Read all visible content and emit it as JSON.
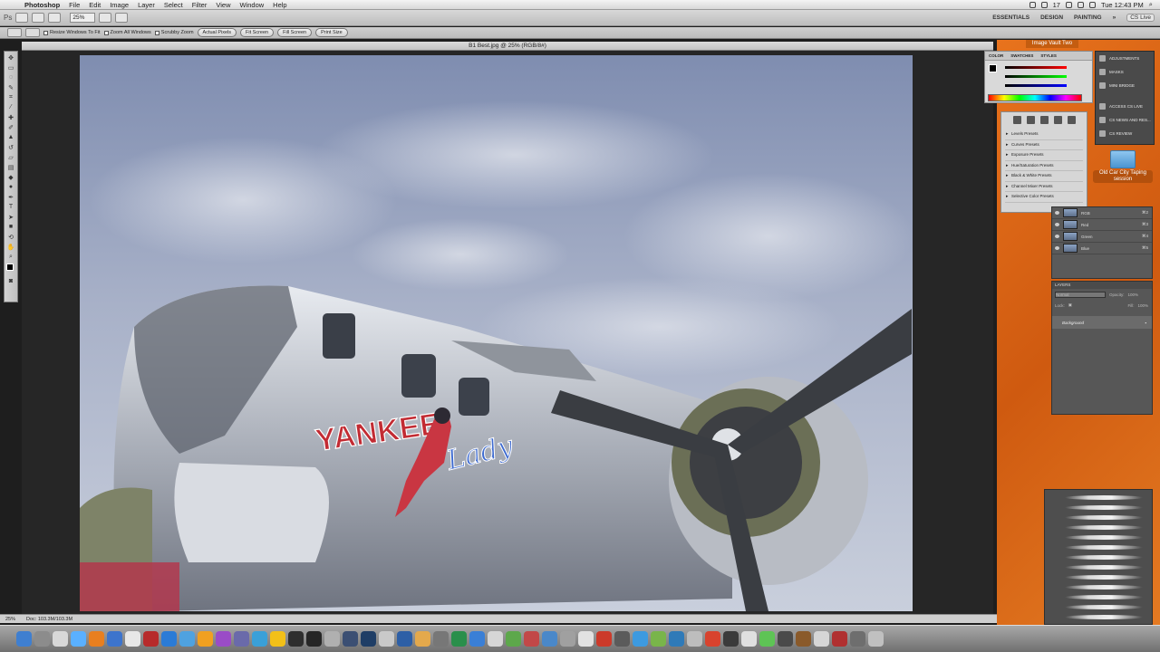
{
  "menubar": {
    "app_name": "Photoshop",
    "items": [
      "File",
      "Edit",
      "Image",
      "Layer",
      "Select",
      "Filter",
      "View",
      "Window",
      "Help"
    ],
    "clock": "Tue 12:43 PM",
    "date_num": "17"
  },
  "appbar": {
    "zoom": "25%",
    "workspaces": [
      "ESSENTIALS",
      "DESIGN",
      "PAINTING"
    ],
    "cs_live": "CS Live"
  },
  "options": {
    "resize_windows": "Resize Windows To Fit",
    "zoom_all": "Zoom All Windows",
    "scrubby": "Scrubby Zoom",
    "buttons": [
      "Actual Pixels",
      "Fit Screen",
      "Fill Screen",
      "Print Size"
    ]
  },
  "document": {
    "title": "B1 Best.jpg @ 25% (RGB/8#)",
    "status_zoom": "25%",
    "status_doc": "Doc: 103.3M/103.3M"
  },
  "photo_text": {
    "nose_art_1": "YANKEE",
    "nose_art_2": "Lady"
  },
  "desktop": {
    "tape_title": "Image Vault Two",
    "folder_label": "Old Car City Taping session"
  },
  "swatch_panel": {
    "tabs": [
      "COLOR",
      "SWATCHES",
      "STYLES"
    ]
  },
  "collapsed_panels": {
    "items": [
      "ADJUSTMENTS",
      "MASKS",
      "MINI BRIDGE",
      "ACCESS CS LIVE",
      "CS NEWS AND RES...",
      "CS REVIEW"
    ]
  },
  "adjustments": {
    "presets": [
      "Levels Presets",
      "Curves Presets",
      "Exposure Presets",
      "Hue/Saturation Presets",
      "Black & White Presets",
      "Channel Mixer Presets",
      "Selective Color Presets"
    ]
  },
  "channels": {
    "rows": [
      {
        "name": "RGB",
        "key": "⌘2"
      },
      {
        "name": "Red",
        "key": "⌘3"
      },
      {
        "name": "Green",
        "key": "⌘4"
      },
      {
        "name": "Blue",
        "key": "⌘5"
      }
    ]
  },
  "layers": {
    "title": "LAYERS",
    "blend": "Normal",
    "opacity_label": "Opacity:",
    "opacity": "100%",
    "lock_label": "Lock:",
    "fill_label": "Fill:",
    "fill": "100%",
    "layer_name": "Background"
  },
  "colors": {
    "desktop_orange": "#e06b18",
    "panel_dark": "#575757",
    "sky": "#9aa5bf"
  }
}
